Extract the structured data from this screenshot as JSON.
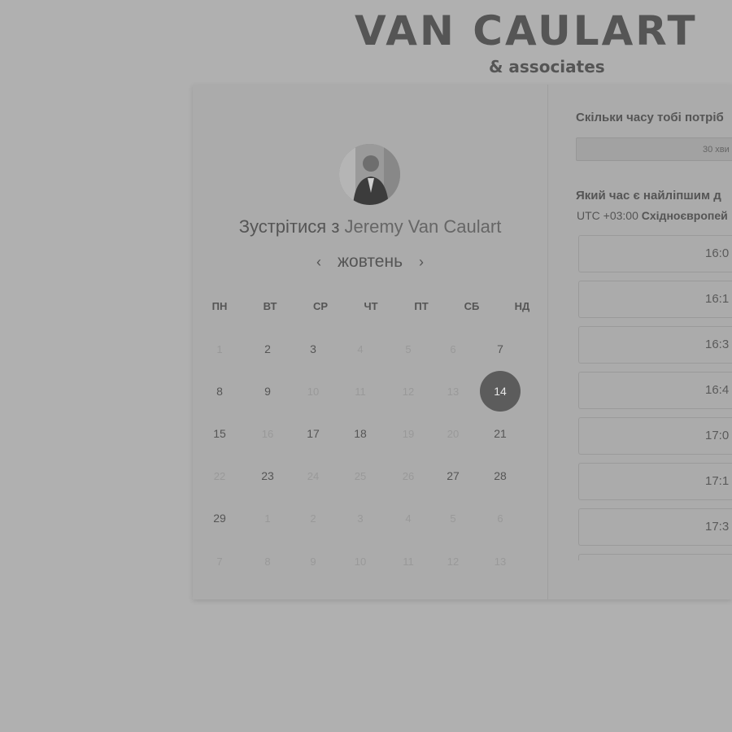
{
  "brand": {
    "name": "VAN CAULART",
    "subtitle": "& associates"
  },
  "booking": {
    "title_prefix": "Зустрітися з",
    "host": "Jeremy Van Caulart",
    "avatar_icon": "person-photo-icon",
    "month": "жовтень",
    "prev_icon": "chevron-left-icon",
    "next_icon": "chevron-right-icon",
    "prev_label": "‹",
    "next_label": "›",
    "weekdays": [
      "ПН",
      "ВТ",
      "СР",
      "ЧТ",
      "ПТ",
      "СБ",
      "НД"
    ],
    "weeks": [
      [
        {
          "d": "1",
          "s": "off"
        },
        {
          "d": "2",
          "s": "on"
        },
        {
          "d": "3",
          "s": "on"
        },
        {
          "d": "4",
          "s": "off"
        },
        {
          "d": "5",
          "s": "off"
        },
        {
          "d": "6",
          "s": "off"
        },
        {
          "d": "7",
          "s": "on"
        }
      ],
      [
        {
          "d": "8",
          "s": "on"
        },
        {
          "d": "9",
          "s": "on"
        },
        {
          "d": "10",
          "s": "off"
        },
        {
          "d": "11",
          "s": "off"
        },
        {
          "d": "12",
          "s": "off"
        },
        {
          "d": "13",
          "s": "off"
        },
        {
          "d": "14",
          "s": "sel"
        }
      ],
      [
        {
          "d": "15",
          "s": "on"
        },
        {
          "d": "16",
          "s": "off"
        },
        {
          "d": "17",
          "s": "on"
        },
        {
          "d": "18",
          "s": "on"
        },
        {
          "d": "19",
          "s": "off"
        },
        {
          "d": "20",
          "s": "off"
        },
        {
          "d": "21",
          "s": "on"
        }
      ],
      [
        {
          "d": "22",
          "s": "off"
        },
        {
          "d": "23",
          "s": "on"
        },
        {
          "d": "24",
          "s": "off"
        },
        {
          "d": "25",
          "s": "off"
        },
        {
          "d": "26",
          "s": "off"
        },
        {
          "d": "27",
          "s": "on"
        },
        {
          "d": "28",
          "s": "on"
        }
      ],
      [
        {
          "d": "29",
          "s": "on"
        },
        {
          "d": "1",
          "s": "off"
        },
        {
          "d": "2",
          "s": "off"
        },
        {
          "d": "3",
          "s": "off"
        },
        {
          "d": "4",
          "s": "off"
        },
        {
          "d": "5",
          "s": "off"
        },
        {
          "d": "6",
          "s": "off"
        }
      ],
      [
        {
          "d": "7",
          "s": "off"
        },
        {
          "d": "8",
          "s": "off"
        },
        {
          "d": "9",
          "s": "off"
        },
        {
          "d": "10",
          "s": "off"
        },
        {
          "d": "11",
          "s": "off"
        },
        {
          "d": "12",
          "s": "off"
        },
        {
          "d": "13",
          "s": "off"
        }
      ]
    ]
  },
  "scheduler": {
    "duration_question": "Скільки часу тобі потріб",
    "duration_value": "30 хви",
    "time_question": "Який час є найліпшим д",
    "timezone_offset": "UTC +03:00",
    "timezone_name": "Східноєвропей",
    "slots": [
      "16:0",
      "16:1",
      "16:3",
      "16:4",
      "17:0",
      "17:1",
      "17:3",
      ""
    ]
  },
  "colors": {
    "background": "#b0b0b0",
    "selected_day": "#5c5c5c"
  }
}
